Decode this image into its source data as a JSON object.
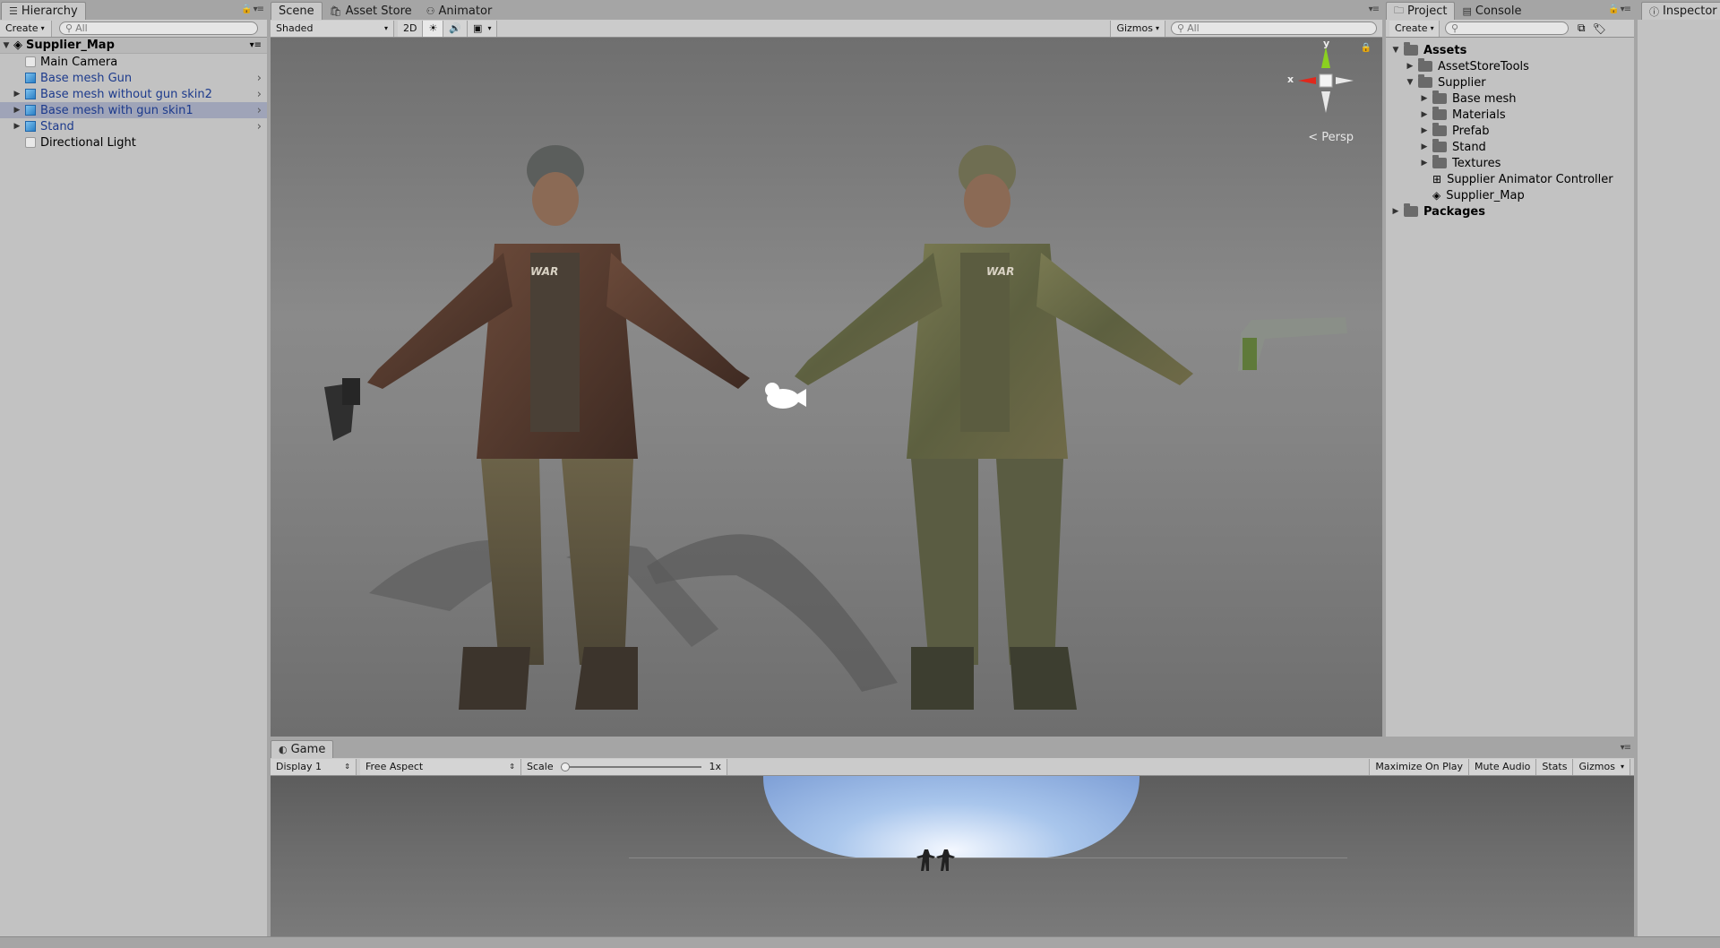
{
  "hierarchy": {
    "tab_label": "Hierarchy",
    "create_label": "Create",
    "search_placeholder": "All",
    "scene_name": "Supplier_Map",
    "items": [
      {
        "label": "Main Camera"
      },
      {
        "label": "Base mesh Gun"
      },
      {
        "label": "Base mesh without gun skin2"
      },
      {
        "label": "Base mesh with gun skin1"
      },
      {
        "label": "Stand"
      },
      {
        "label": "Directional Light"
      }
    ]
  },
  "scene": {
    "tabs": [
      {
        "label": "Scene"
      },
      {
        "label": "Asset Store"
      },
      {
        "label": "Animator"
      }
    ],
    "shading_mode": "Shaded",
    "toggle_2d": "2D",
    "gizmos_label": "Gizmos",
    "search_placeholder": "All",
    "gizmo_axes": {
      "x": "x",
      "y": "y"
    },
    "persp_label": "Persp",
    "text_on_chest": "WAR"
  },
  "project": {
    "tabs": [
      {
        "label": "Project"
      },
      {
        "label": "Console"
      }
    ],
    "create_label": "Create",
    "tree": [
      {
        "label": "Assets"
      },
      {
        "label": "AssetStoreTools"
      },
      {
        "label": "Supplier"
      },
      {
        "label": "Base mesh"
      },
      {
        "label": "Materials"
      },
      {
        "label": "Prefab"
      },
      {
        "label": "Stand"
      },
      {
        "label": "Textures"
      },
      {
        "label": "Supplier Animator Controller"
      },
      {
        "label": "Supplier_Map"
      },
      {
        "label": "Packages"
      }
    ]
  },
  "inspector": {
    "tab_label": "Inspector"
  },
  "game": {
    "tab_label": "Game",
    "display": "Display 1",
    "aspect": "Free Aspect",
    "scale_label": "Scale",
    "scale_value": "1x",
    "buttons": [
      {
        "label": "Maximize On Play"
      },
      {
        "label": "Mute Audio"
      },
      {
        "label": "Stats"
      },
      {
        "label": "Gizmos"
      }
    ]
  },
  "colors": {
    "panel_bg": "#c2c2c2",
    "selected_row": "#9fa4b8",
    "link_blue": "#1c3a8c",
    "axis_x": "#e0281c",
    "axis_y": "#8bd020"
  }
}
